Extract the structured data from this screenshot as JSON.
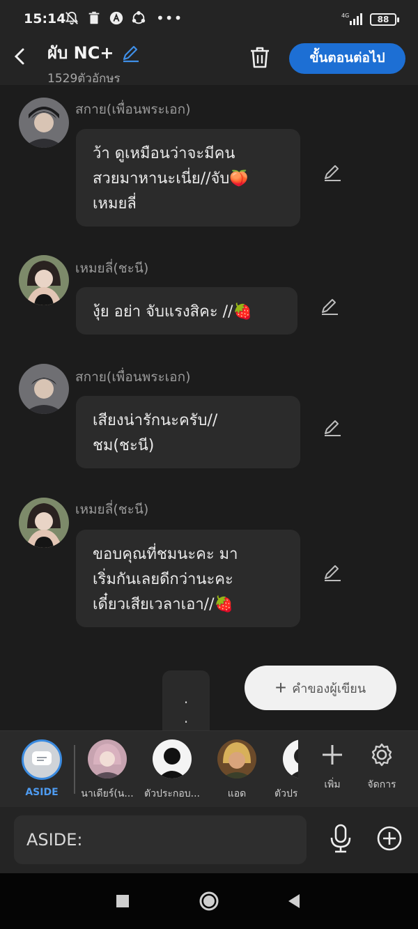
{
  "status_bar": {
    "time": "15:14",
    "battery": "88",
    "network": "4G"
  },
  "header": {
    "title": "ผับ NC+",
    "char_count": "1529ตัวอักษร",
    "next_button": "ขั้นตอนต่อไป"
  },
  "messages": [
    {
      "sender": "สกาย(เพื่อนพระเอก)",
      "text": "ว้า ดูเหมือนว่าจะมีคน\nสวยมาหานะเนี่ย//จับ🍑\nเหมยลี่",
      "avatar": "sky"
    },
    {
      "sender": "เหมยลี่(ชะนี)",
      "text": "งุ้ย อย่า จับแรงสิคะ //🍓",
      "avatar": "meili"
    },
    {
      "sender": "สกาย(เพื่อนพระเอก)",
      "text": "เสียงน่ารักนะครับ//\nชม(ชะนี)",
      "avatar": "sky"
    },
    {
      "sender": "เหมยลี่(ชะนี)",
      "text": "ขอบคุณที่ชมนะคะ มา\nเริ่มกันเลยดีกว่านะคะ\nเดี๋ยวเสียเวลาเอา//🍓",
      "avatar": "meili"
    }
  ],
  "ellipsis": ".\n.",
  "author_button": "คำของผู้เขียน",
  "characters": {
    "aside": "ASIDE",
    "items": [
      {
        "name": "นาเดียร์(น..."
      },
      {
        "name": "ตัวประกอบ..."
      },
      {
        "name": "แอด"
      },
      {
        "name": "ตัวปร"
      }
    ],
    "add_label": "เพิ่ม",
    "manage_label": "จัดการ"
  },
  "input": {
    "value": "ASIDE:"
  },
  "colors": {
    "accent": "#1d6fd4",
    "aside_accent": "#4e9bf0",
    "background": "#1c1c1c",
    "bubble": "#2b2b2b"
  }
}
